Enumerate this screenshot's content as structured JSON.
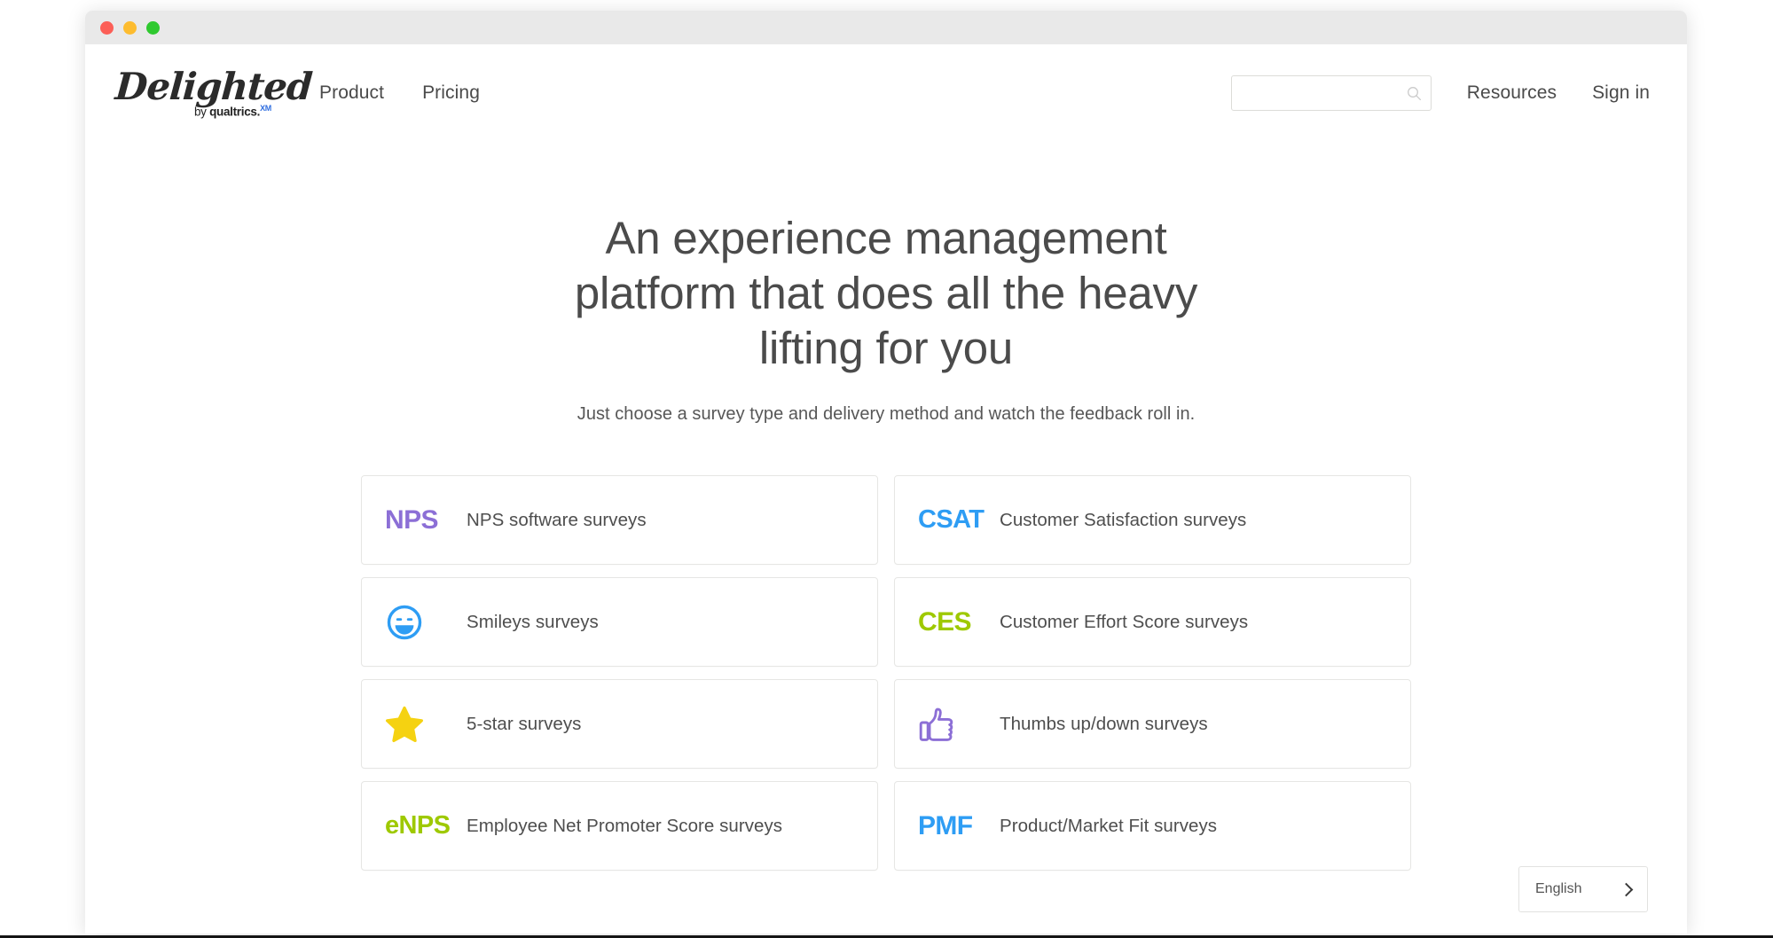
{
  "window": {
    "traffic_lights": [
      "close",
      "minimize",
      "zoom"
    ],
    "colors": {
      "close": "#fc5f57",
      "minimize": "#fdbc2f",
      "zoom": "#2fc92f",
      "titlebar": "#e9e9e9"
    }
  },
  "header": {
    "logo": {
      "word": "Delighted",
      "by": "by",
      "brand": "qualtrics.",
      "superscript": "XM"
    },
    "nav": [
      {
        "label": "Product"
      },
      {
        "label": "Pricing"
      }
    ],
    "search": {
      "value": "",
      "placeholder": "",
      "icon": "search-icon"
    },
    "right_links": [
      {
        "label": "Resources"
      },
      {
        "label": "Sign in"
      }
    ]
  },
  "hero": {
    "heading": "An experience management platform that does all the heavy lifting for you",
    "subheading": "Just choose a survey type and delivery method and watch the feedback roll in."
  },
  "survey_types": [
    {
      "badge_type": "text",
      "badge_text": "NPS",
      "color": "#8c6fd6",
      "label": "NPS software surveys",
      "icon": "nps-text-badge"
    },
    {
      "badge_type": "text",
      "badge_text": "CSAT",
      "color": "#2e9df4",
      "label": "Customer Satisfaction surveys",
      "icon": "csat-text-badge"
    },
    {
      "badge_type": "icon",
      "badge_text": "",
      "color": "#2e9df4",
      "label": "Smileys surveys",
      "icon": "smiley-icon"
    },
    {
      "badge_type": "text",
      "badge_text": "CES",
      "color": "#9ec900",
      "label": "Customer Effort Score surveys",
      "icon": "ces-text-badge"
    },
    {
      "badge_type": "icon",
      "badge_text": "",
      "color": "#f5d211",
      "label": "5-star surveys",
      "icon": "star-icon"
    },
    {
      "badge_type": "icon",
      "badge_text": "",
      "color": "#8c6fd6",
      "label": "Thumbs up/down surveys",
      "icon": "thumbs-up-icon"
    },
    {
      "badge_type": "text",
      "badge_text": "eNPS",
      "color": "#9ec900",
      "label": "Employee Net Promoter Score surveys",
      "icon": "enps-text-badge"
    },
    {
      "badge_type": "text",
      "badge_text": "PMF",
      "color": "#2e9df4",
      "label": "Product/Market Fit surveys",
      "icon": "pmf-text-badge"
    }
  ],
  "language_selector": {
    "label": "English",
    "icon": "chevron-right-icon"
  }
}
